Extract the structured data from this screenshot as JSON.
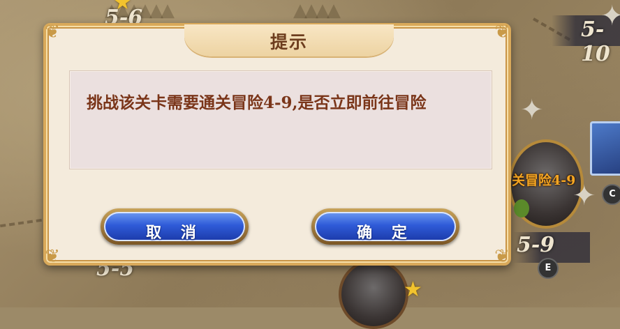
{
  "background": {
    "stage_labels": [
      "5-6",
      "5-10",
      "5-9",
      "5-5"
    ],
    "locked_tag": "关冒险4-9",
    "badges": [
      "C",
      "E"
    ]
  },
  "dialog": {
    "title": "提示",
    "message": "挑战该关卡需要通关冒险4-9,是否立即前往冒险",
    "cancel_label": "取 消",
    "confirm_label": "确 定"
  }
}
